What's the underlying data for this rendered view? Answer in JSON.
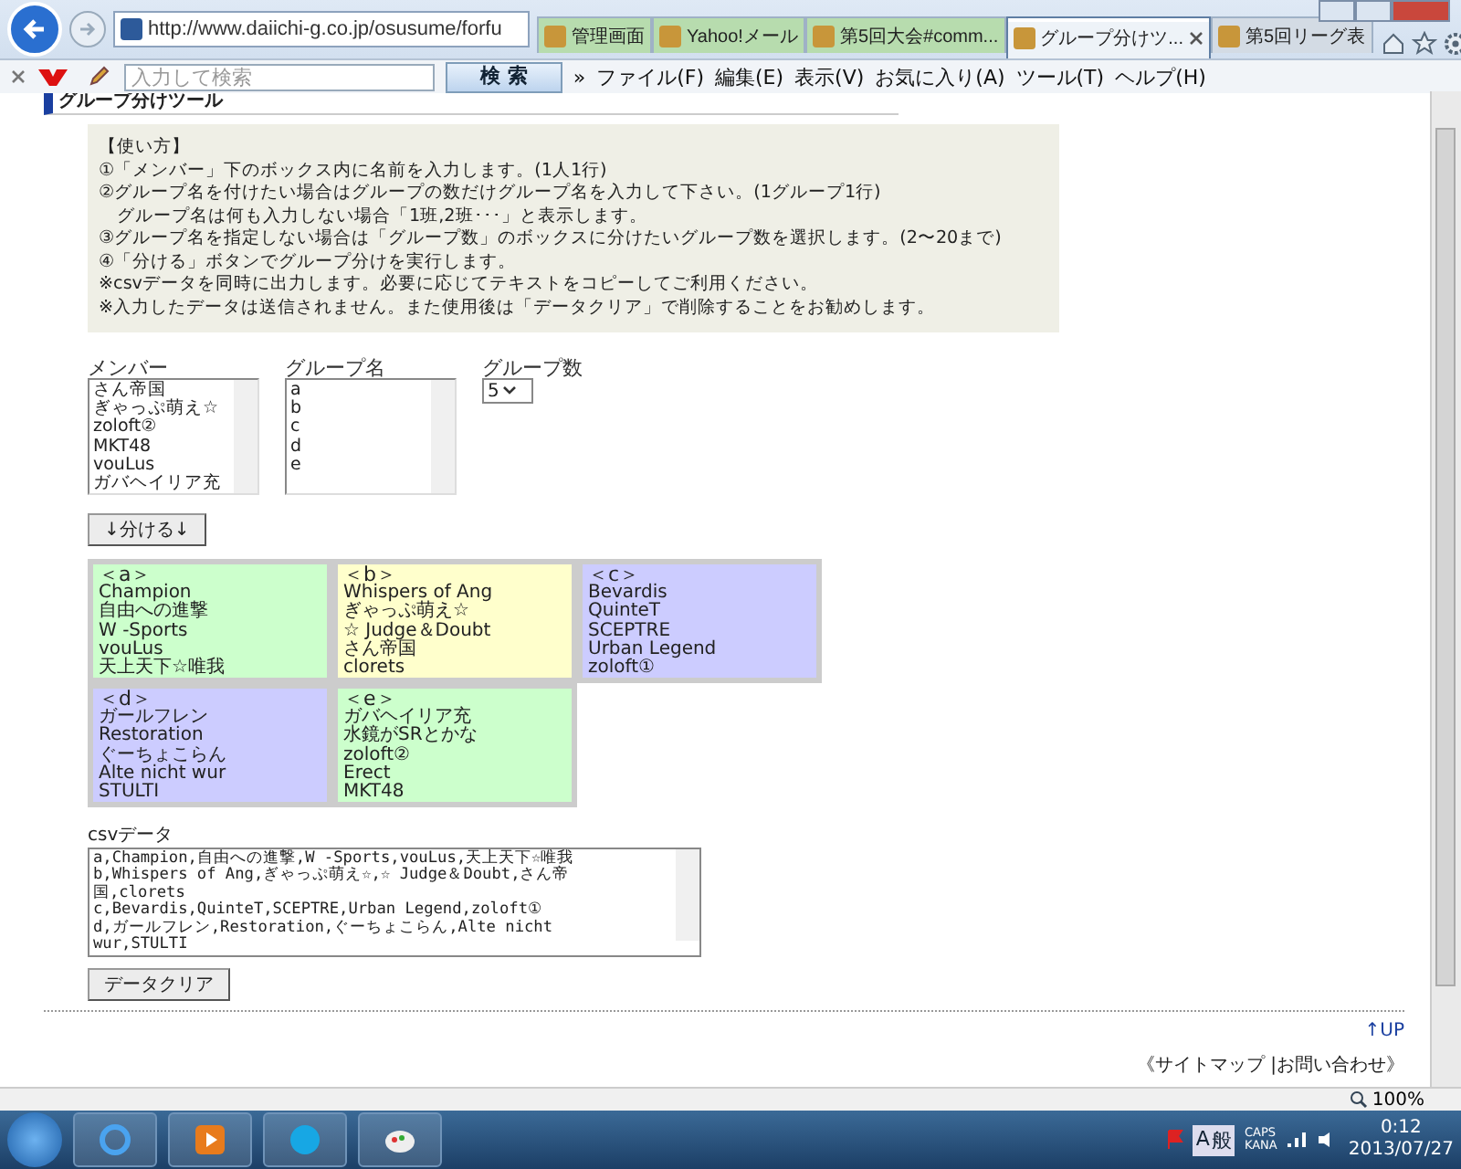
{
  "browser": {
    "address": "http://www.daiichi-g.co.jp/osusume/forfu",
    "tabs": [
      {
        "label": "管理画面",
        "selected": false,
        "color": "#b7dcae"
      },
      {
        "label": "Yahoo!メール",
        "selected": false,
        "color": "#b7dcae"
      },
      {
        "label": "第5回大会#comm...",
        "selected": false,
        "color": "#b7dcae"
      },
      {
        "label": "グループ分けツ...",
        "selected": true,
        "color": "#eef3f8"
      },
      {
        "label": "第5回リーグ表",
        "selected": false,
        "color": "#d3dbe4"
      }
    ],
    "toolbar": {
      "search_placeholder": "入力して検索",
      "search_button": "検 索",
      "more": "»",
      "menu": [
        "ファイル(F)",
        "編集(E)",
        "表示(V)",
        "お気に入り(A)",
        "ツール(T)",
        "ヘルプ(H)"
      ]
    }
  },
  "page": {
    "title": "グループ分けツール",
    "instructions": [
      "【使い方】",
      "①「メンバー」下のボックス内に名前を入力します。(1人1行)",
      "②グループ名を付けたい場合はグループの数だけグループ名を入力して下さい。(1グループ1行)",
      "　グループ名は何も入力しない場合「1班,2班･･･」と表示します。",
      "③グループ名を指定しない場合は「グループ数」のボックスに分けたいグループ数を選択します。(2〜20まで)",
      "④「分ける」ボタンでグループ分けを実行します。",
      "※csvデータを同時に出力します。必要に応じてテキストをコピーしてご利用ください。",
      "※入力したデータは送信されません。また使用後は「データクリア」で削除することをお勧めします。"
    ],
    "members": {
      "label": "メンバー",
      "lines": [
        "さん帝国",
        "ぎゃっぷ萌え☆",
        "zoloft②",
        "MKT48",
        "vouLus",
        "ガバヘイリア充"
      ]
    },
    "group_names": {
      "label": "グループ名",
      "lines": [
        "a",
        "b",
        "c",
        "d",
        "e"
      ]
    },
    "group_count": {
      "label": "グループ数",
      "value": "5"
    },
    "split_button": "↓分ける↓",
    "groups": [
      {
        "name": "＜a＞",
        "color": "#ccffcc",
        "members": [
          "Champion",
          "自由への進撃",
          "W -Sports",
          "vouLus",
          "天上天下☆唯我"
        ]
      },
      {
        "name": "＜b＞",
        "color": "#ffffcc",
        "members": [
          "Whispers of Ang",
          "ぎゃっぷ萌え☆",
          "☆ Judge＆Doubt",
          "さん帝国",
          "clorets"
        ]
      },
      {
        "name": "＜c＞",
        "color": "#ccccff",
        "members": [
          "Bevardis",
          "QuinteT",
          "SCEPTRE",
          "Urban Legend",
          "zoloft①"
        ]
      },
      {
        "name": "＜d＞",
        "color": "#ccccff",
        "members": [
          "ガールフレン",
          "Restoration",
          "ぐーちょこらん",
          "Alte nicht wur",
          "STULTI"
        ]
      },
      {
        "name": "＜e＞",
        "color": "#ccffcc",
        "members": [
          "ガバヘイリア充",
          "水鏡がSRとかな",
          "zoloft②",
          "Erect",
          "MKT48"
        ]
      }
    ],
    "csv": {
      "label": "csvデータ",
      "lines": [
        "a,Champion,自由への進撃,W -Sports,vouLus,天上天下☆唯我",
        "b,Whispers of Ang,ぎゃっぷ萌え☆,☆ Judge＆Doubt,さん帝",
        "国,clorets",
        "c,Bevardis,QuinteT,SCEPTRE,Urban Legend,zoloft①",
        "d,ガールフレン,Restoration,ぐーちょこらん,Alte nicht",
        "wur,STULTI"
      ]
    },
    "clear_button": "データクリア",
    "up_link": "↑UP",
    "footer": "《サイトマップ |お問い合わせ》"
  },
  "status_bar": {
    "zoom": "100%"
  },
  "taskbar": {
    "ime_mode": "A",
    "ime_label": "般",
    "caps": "CAPS",
    "kana": "KANA",
    "time": "0:12",
    "date": "2013/07/27"
  }
}
